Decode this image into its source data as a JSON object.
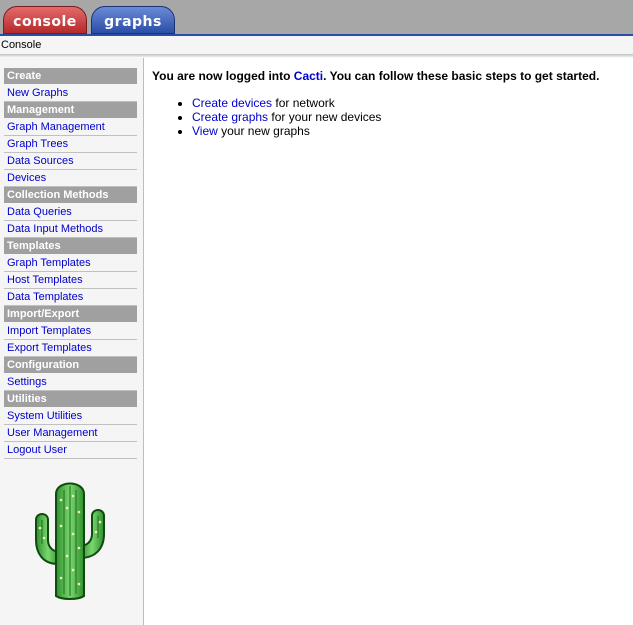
{
  "tabs": [
    {
      "label": "console"
    },
    {
      "label": "graphs"
    }
  ],
  "breadcrumb": "Console",
  "menu": {
    "create": {
      "header": "Create",
      "items": [
        "New Graphs"
      ]
    },
    "management": {
      "header": "Management",
      "items": [
        "Graph Management",
        "Graph Trees",
        "Data Sources",
        "Devices"
      ]
    },
    "collection": {
      "header": "Collection Methods",
      "items": [
        "Data Queries",
        "Data Input Methods"
      ]
    },
    "templates": {
      "header": "Templates",
      "items": [
        "Graph Templates",
        "Host Templates",
        "Data Templates"
      ]
    },
    "importexport": {
      "header": "Import/Export",
      "items": [
        "Import Templates",
        "Export Templates"
      ]
    },
    "configuration": {
      "header": "Configuration",
      "items": [
        "Settings"
      ]
    },
    "utilities": {
      "header": "Utilities",
      "items": [
        "System Utilities",
        "User Management",
        "Logout User"
      ]
    }
  },
  "intro": {
    "prefix": "You are now logged into ",
    "link": "Cacti",
    "suffix": ". You can follow these basic steps to get started."
  },
  "steps": [
    {
      "link": "Create devices",
      "text": " for network"
    },
    {
      "link": "Create graphs",
      "text": " for your new devices"
    },
    {
      "link": "View",
      "text": " your new graphs"
    }
  ],
  "colors": {
    "accent_blue": "#2a4ea6",
    "link": "#0000cc",
    "console_tab": "#b52a2a",
    "cactus_green": "#4cb84a"
  },
  "icons": {
    "logo": "cactus-logo-icon"
  }
}
